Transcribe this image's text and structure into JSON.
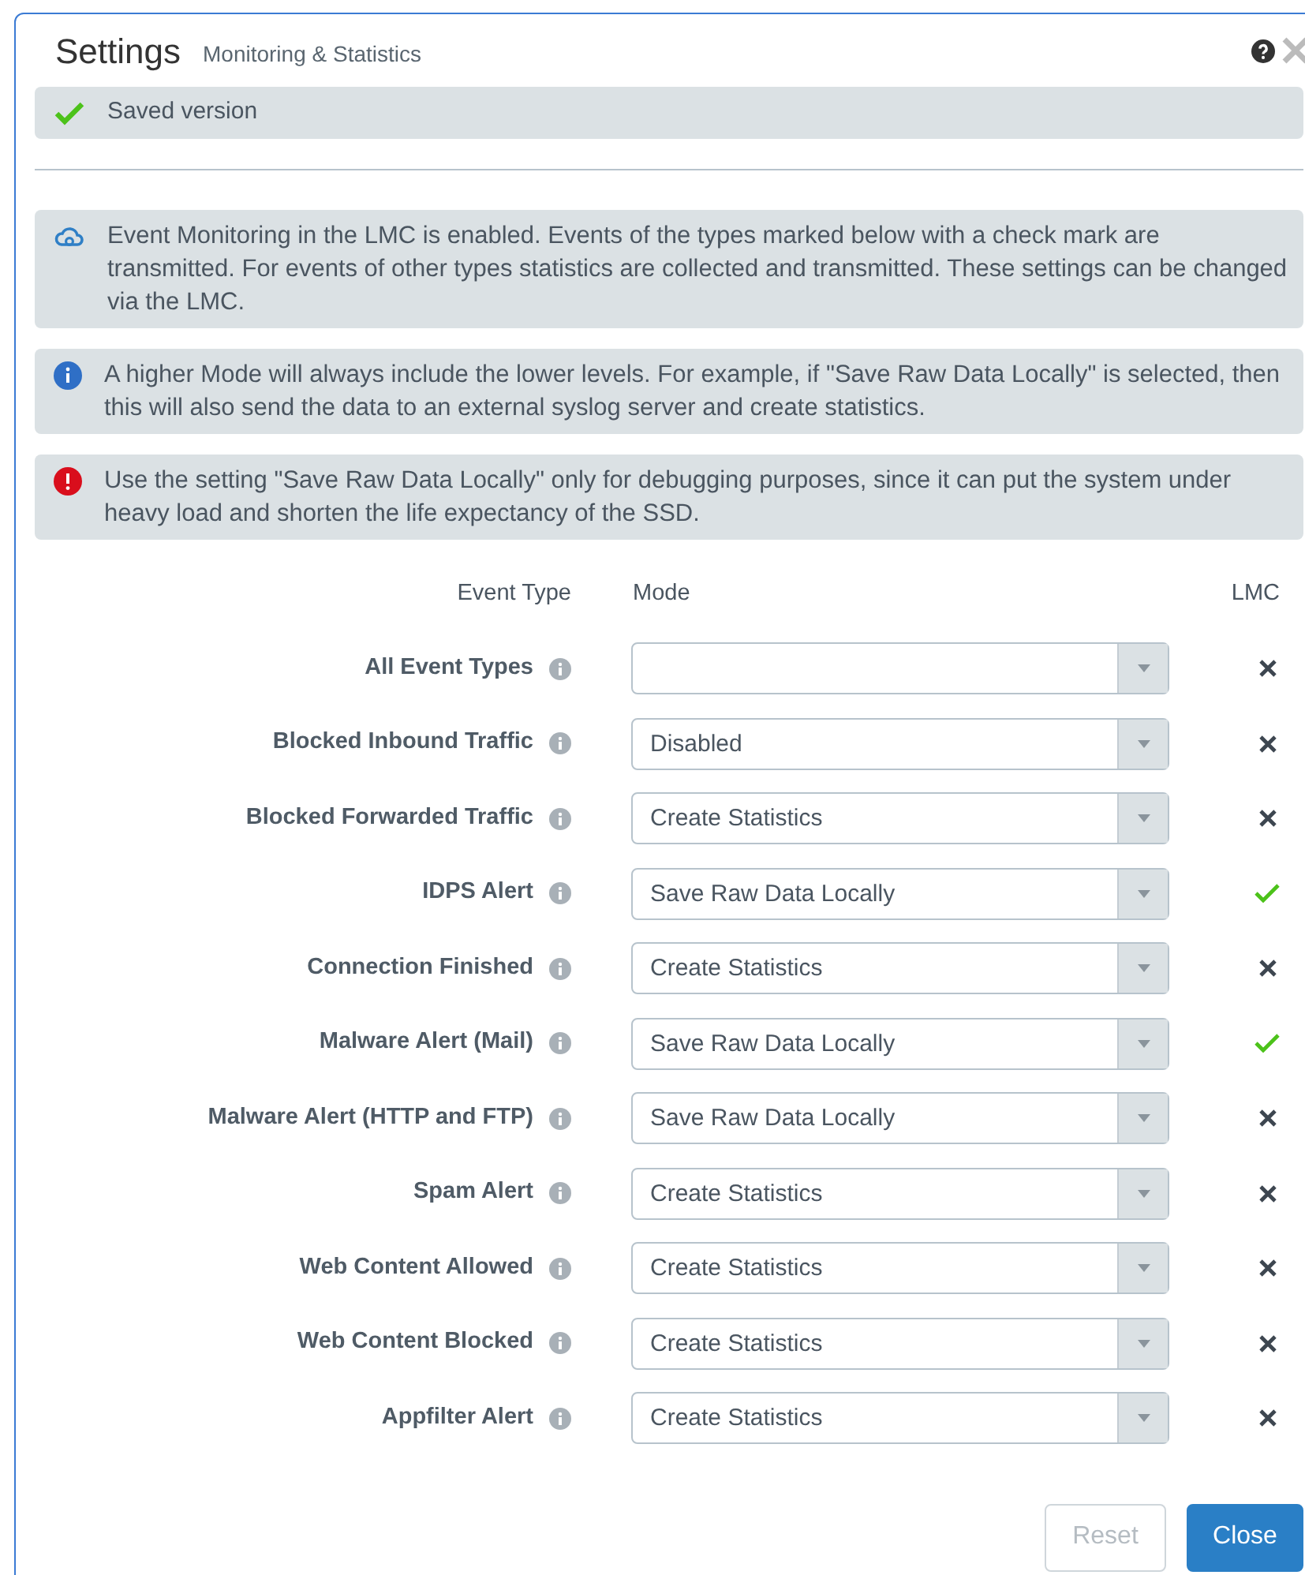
{
  "dialog": {
    "title": "Settings",
    "subtitle": "Monitoring & Statistics"
  },
  "status": {
    "text": "Saved version"
  },
  "notices": [
    {
      "kind": "cloud",
      "text": "Event Monitoring in the LMC is enabled. Events of the types marked below with a check mark are transmitted. For events of other types statistics are collected and transmitted. These settings can be changed via the LMC."
    },
    {
      "kind": "info",
      "text": "A higher Mode will always include the lower levels. For example, if \"Save Raw Data Locally\" is selected, then this will also send the data to an external syslog server and create statistics."
    },
    {
      "kind": "error",
      "text": "Use the setting \"Save Raw Data Locally\" only for debugging purposes, since it can put the system under heavy load and shorten the life expectancy of the SSD."
    }
  ],
  "table": {
    "columns": [
      "Event Type",
      "Mode",
      "LMC"
    ],
    "rows": [
      {
        "event_type": "All Event Types",
        "mode": "",
        "lmc": false
      },
      {
        "event_type": "Blocked Inbound Traffic",
        "mode": "Disabled",
        "lmc": false
      },
      {
        "event_type": "Blocked Forwarded Traffic",
        "mode": "Create Statistics",
        "lmc": false
      },
      {
        "event_type": "IDPS Alert",
        "mode": "Save Raw Data Locally",
        "lmc": true
      },
      {
        "event_type": "Connection Finished",
        "mode": "Create Statistics",
        "lmc": false
      },
      {
        "event_type": "Malware Alert (Mail)",
        "mode": "Save Raw Data Locally",
        "lmc": true
      },
      {
        "event_type": "Malware Alert (HTTP and FTP)",
        "mode": "Save Raw Data Locally",
        "lmc": false
      },
      {
        "event_type": "Spam Alert",
        "mode": "Create Statistics",
        "lmc": false
      },
      {
        "event_type": "Web Content Allowed",
        "mode": "Create Statistics",
        "lmc": false
      },
      {
        "event_type": "Web Content Blocked",
        "mode": "Create Statistics",
        "lmc": false
      },
      {
        "event_type": "Appfilter Alert",
        "mode": "Create Statistics",
        "lmc": false
      }
    ]
  },
  "buttons": [
    {
      "label": "Reset",
      "kind": "secondary",
      "disabled": true
    },
    {
      "label": "Close",
      "kind": "primary",
      "disabled": false
    }
  ]
}
